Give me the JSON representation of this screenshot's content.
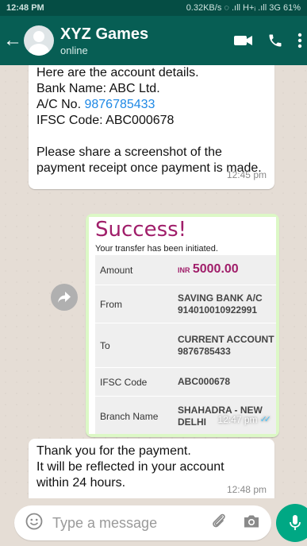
{
  "status_bar": {
    "time": "12:48 PM",
    "right": "0.32KB/s ◌ .ıll H+ᵢ .ıll 3G 61%"
  },
  "header": {
    "contact_name": "XYZ Games",
    "contact_status": "online"
  },
  "messages": {
    "m1": {
      "line1": "Here are the account details.\nBank Name: ABC Ltd.\nA/C No. ",
      "account_link": "9876785433",
      "line2": "\nIFSC Code: ABC000678\n\nPlease share a screenshot of the payment receipt once payment is made.",
      "time": "12:45 pm"
    },
    "m2": {
      "title": "Success!",
      "subtitle": "Your transfer has been initiated.",
      "rows": [
        {
          "label": "Amount",
          "currency": "INR",
          "value": "5000.00"
        },
        {
          "label": "From",
          "value": "SAVING BANK A/C\n914010010922991"
        },
        {
          "label": "To",
          "value": "CURRENT ACCOUNT\n9876785433"
        },
        {
          "label": "IFSC Code",
          "value": "ABC000678"
        },
        {
          "label": "Branch Name",
          "value": "SHAHADRA - NEW\nDELHI"
        }
      ],
      "time": "12:47 pm"
    },
    "m3": {
      "text": "Thank you for the payment.\nIt will be reflected in your account\nwithin 24 hours.",
      "time": "12:48 pm"
    }
  },
  "composer": {
    "placeholder": "Type a message"
  },
  "colors": {
    "header": "#075e54",
    "outgoing": "#dcf8c6",
    "accent": "#00a884"
  }
}
